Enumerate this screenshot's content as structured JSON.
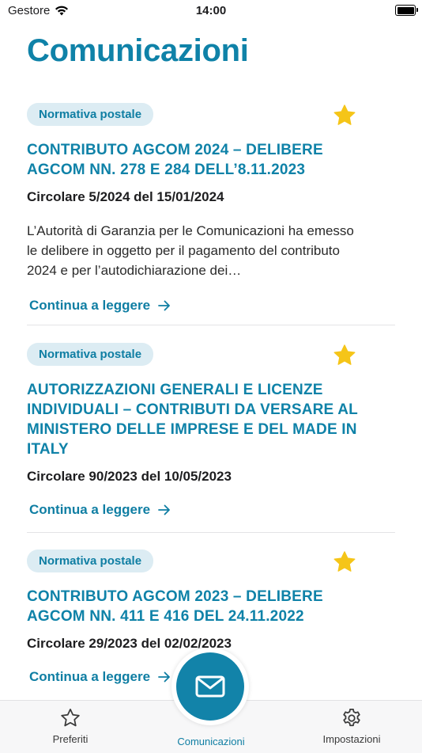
{
  "status_bar": {
    "carrier": "Gestore",
    "time": "14:00"
  },
  "page_title": "Comunicazioni",
  "cards": [
    {
      "tag": "Normativa postale",
      "title": "CONTRIBUTO AGCOM 2024 – DELIBERE AGCOM NN. 278 E 284 DELL’8.11.2023",
      "circolare": "Circolare 5/2024 del 15/01/2024",
      "excerpt": "L’Autorità di Garanzia per le Comunicazioni ha emesso le delibere in oggetto per il pagamento del contributo 2024 e per l’autodichiarazione dei…",
      "read_more": "Continua a leggere"
    },
    {
      "tag": "Normativa postale",
      "title": "AUTORIZZAZIONI GENERALI E LICENZE INDIVIDUALI – CONTRIBUTI DA VERSARE AL MINISTERO DELLE IMPRESE E DEL MADE IN ITALY",
      "circolare": "Circolare 90/2023 del 10/05/2023",
      "read_more": "Continua a leggere"
    },
    {
      "tag": "Normativa postale",
      "title": "CONTRIBUTO AGCOM 2023 – DELIBERE AGCOM NN. 411 E 416 DEL 24.11.2022",
      "circolare": "Circolare 29/2023 del 02/02/2023",
      "read_more": "Continua a leggere"
    }
  ],
  "tabbar": {
    "preferiti": "Preferiti",
    "comunicazioni": "Comunicazioni",
    "impostazioni": "Impostazioni"
  },
  "colors": {
    "accent": "#0f82a8",
    "star": "#f5c518",
    "tag_bg": "#dcecf3"
  },
  "icons": [
    "wifi-icon",
    "battery-icon",
    "star-icon",
    "arrow-right-icon",
    "mail-icon",
    "star-outline-icon",
    "gear-icon"
  ]
}
